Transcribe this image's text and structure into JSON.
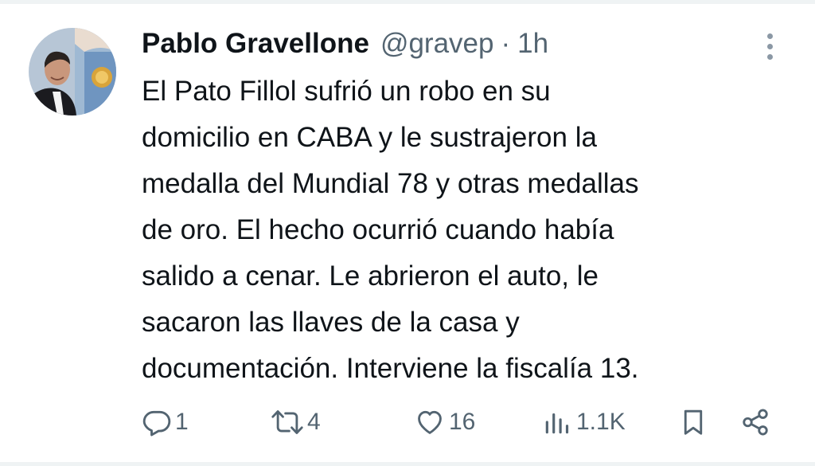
{
  "tweet": {
    "author": {
      "name": "Pablo Gravellone",
      "handle": "@gravep",
      "separator": "·",
      "time": "1h"
    },
    "text_lines": [
      "El Pato Fillol sufrió un robo en su",
      "domicilio en CABA y le sustrajeron la",
      "medalla del Mundial 78 y otras medallas",
      "de oro. El hecho ocurrió cuando había",
      "salido a cenar. Le abrieron el auto, le",
      "sacaron las llaves de la casa y",
      "documentación. Interviene la fiscalía 13."
    ],
    "actions": {
      "replies": "1",
      "retweets": "4",
      "likes": "16",
      "views": "1.1K"
    }
  },
  "colors": {
    "text": "#0f1419",
    "secondary": "#536471",
    "border": "#eff3f4",
    "more_dots": "#8b98a5"
  },
  "icons": {
    "reply": "reply-icon",
    "retweet": "retweet-icon",
    "like": "heart-icon",
    "views": "views-icon",
    "bookmark": "bookmark-icon",
    "share": "share-icon",
    "more": "more-icon"
  }
}
